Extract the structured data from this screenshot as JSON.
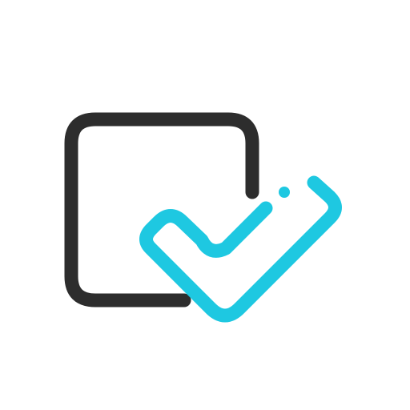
{
  "icon": {
    "name": "checkbox-check-icon",
    "colors": {
      "box": "#2d2d2d",
      "check": "#1ec8e1",
      "background": "#ffffff"
    }
  }
}
